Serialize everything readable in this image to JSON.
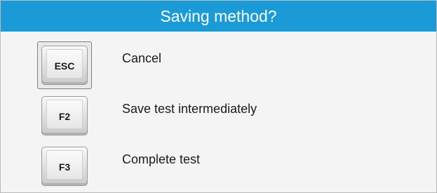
{
  "dialog": {
    "title": "Saving method?",
    "options": [
      {
        "key": "ESC",
        "label": "Cancel",
        "selected": true
      },
      {
        "key": "F2",
        "label": "Save test intermediately",
        "selected": false
      },
      {
        "key": "F3",
        "label": "Complete test",
        "selected": false
      }
    ]
  },
  "colors": {
    "title_bar": "#1a9bd8",
    "background": "#f4f4f4"
  }
}
